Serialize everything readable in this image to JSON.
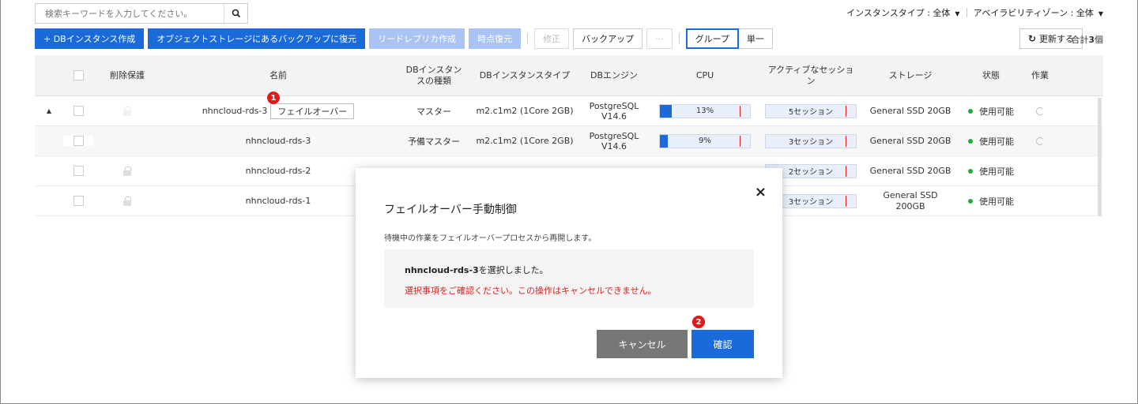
{
  "search": {
    "placeholder": "検索キーワードを入力してください。"
  },
  "filters": {
    "instance_type": "インスタンスタイプ : 全体",
    "availability_zone": "アベイラビリティゾーン : 全体"
  },
  "toolbar": {
    "create_db": "+ DBインスタンス作成",
    "restore_backup": "オブジェクトストレージにあるバックアップに復元",
    "read_replica": "リードレプリカ作成",
    "point_restore": "時点復元",
    "modify": "修正",
    "backup": "バックアップ",
    "more": "···",
    "group": "グループ",
    "single": "単一",
    "refresh": "更新する",
    "total_prefix": "合計",
    "total_count": "3",
    "total_suffix": "個"
  },
  "table": {
    "headers": {
      "delete_protect": "削除保護",
      "name": "名前",
      "kind": "DBインスタンスの種類",
      "type": "DBインスタンスタイプ",
      "engine": "DBエンジン",
      "cpu": "CPU",
      "sessions": "アクティブなセッション",
      "storage": "ストレージ",
      "state": "状態",
      "action": "作業"
    },
    "rows": [
      {
        "name": "nhncloud-rds-3",
        "failover_label": "フェイルオーバー",
        "kind": "マスター",
        "type": "m2.c1m2 (1Core 2GB)",
        "engine": "PostgreSQL V14.6",
        "cpu": "13%",
        "cpu_fraction": 0.13,
        "sessions": "5セッション",
        "storage": "General SSD 20GB",
        "state": "使用可能"
      },
      {
        "name": "nhncloud-rds-3",
        "kind": "予備マスター",
        "type": "m2.c1m2 (1Core 2GB)",
        "engine": "PostgreSQL V14.6",
        "cpu": "9%",
        "cpu_fraction": 0.09,
        "sessions": "3セッション",
        "storage": "General SSD 20GB",
        "state": "使用可能"
      },
      {
        "name": "nhncloud-rds-2",
        "sessions": "2セッション",
        "storage": "General SSD 20GB",
        "state": "使用可能"
      },
      {
        "name": "nhncloud-rds-1",
        "sessions": "3セッション",
        "storage": "General SSD 200GB",
        "state": "使用可能"
      }
    ]
  },
  "badges": {
    "one": "1",
    "two": "2"
  },
  "modal": {
    "title": "フェイルオーバー手動制御",
    "description": "待機中の作業をフェイルオーバープロセスから再開します。",
    "selected_name": "nhncloud-rds-3",
    "selected_suffix": "を選択しました。",
    "warning": "選択事項をご確認ください。この操作はキャンセルできません。",
    "cancel": "キャンセル",
    "confirm": "確認",
    "close": "×"
  },
  "colors": {
    "primary": "#1a6ad9",
    "available": "#22aa44",
    "warning": "#e01e1e"
  }
}
